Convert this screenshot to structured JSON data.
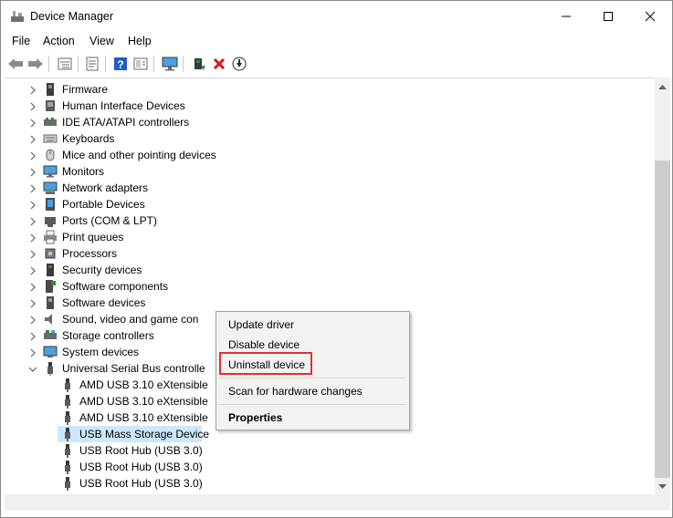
{
  "window": {
    "title": "Device Manager",
    "controls": {
      "minimize": "—",
      "maximize": "□",
      "close": "✕"
    }
  },
  "menu": [
    "File",
    "Action",
    "View",
    "Help"
  ],
  "toolbar": {
    "icons": [
      "back-arrow-icon",
      "forward-arrow-icon",
      "tree-view-icon",
      "properties-icon",
      "help-icon",
      "action-icon",
      "monitor-icon",
      "update-driver-icon",
      "uninstall-icon",
      "download-icon"
    ],
    "colors": {
      "uninstall_x": "#e01010",
      "help_blue": "#1e5fbf",
      "update_green": "#2a8f2a"
    }
  },
  "tree": {
    "categories": [
      {
        "label": "Firmware",
        "icon": "firmware-icon"
      },
      {
        "label": "Human Interface Devices",
        "icon": "hid-icon"
      },
      {
        "label": "IDE ATA/ATAPI controllers",
        "icon": "ide-controller-icon"
      },
      {
        "label": "Keyboards",
        "icon": "keyboard-icon"
      },
      {
        "label": "Mice and other pointing devices",
        "icon": "mouse-icon"
      },
      {
        "label": "Monitors",
        "icon": "monitor-icon"
      },
      {
        "label": "Network adapters",
        "icon": "network-adapter-icon"
      },
      {
        "label": "Portable Devices",
        "icon": "portable-device-icon"
      },
      {
        "label": "Ports (COM & LPT)",
        "icon": "port-icon"
      },
      {
        "label": "Print queues",
        "icon": "printer-icon"
      },
      {
        "label": "Processors",
        "icon": "processor-icon"
      },
      {
        "label": "Security devices",
        "icon": "security-device-icon"
      },
      {
        "label": "Software components",
        "icon": "software-component-icon"
      },
      {
        "label": "Software devices",
        "icon": "software-device-icon"
      },
      {
        "label": "Sound, video and game con",
        "icon": "speaker-icon"
      },
      {
        "label": "Storage controllers",
        "icon": "storage-controller-icon"
      },
      {
        "label": "System devices",
        "icon": "system-device-icon"
      },
      {
        "label": "Universal Serial Bus controlle",
        "icon": "usb-controller-icon",
        "expanded": true
      }
    ],
    "usb_children": [
      {
        "label": "AMD USB 3.10 eXtensible",
        "selected": false
      },
      {
        "label": "AMD USB 3.10 eXtensible",
        "selected": false
      },
      {
        "label": "AMD USB 3.10 eXtensible",
        "selected": false
      },
      {
        "label": "USB Mass Storage Device",
        "selected": true
      },
      {
        "label": "USB Root Hub (USB 3.0)",
        "selected": false
      },
      {
        "label": "USB Root Hub (USB 3.0)",
        "selected": false
      },
      {
        "label": "USB Root Hub (USB 3.0)",
        "selected": false
      }
    ],
    "selection_color": "#cce8ff"
  },
  "context_menu": {
    "items": [
      {
        "label": "Update driver",
        "bold": false
      },
      {
        "label": "Disable device",
        "bold": false
      },
      {
        "label": "Uninstall device",
        "bold": false,
        "highlighted": true
      },
      {
        "label": "Scan for hardware changes",
        "bold": false
      },
      {
        "label": "Properties",
        "bold": true
      }
    ],
    "highlight_color": "#e03030"
  }
}
